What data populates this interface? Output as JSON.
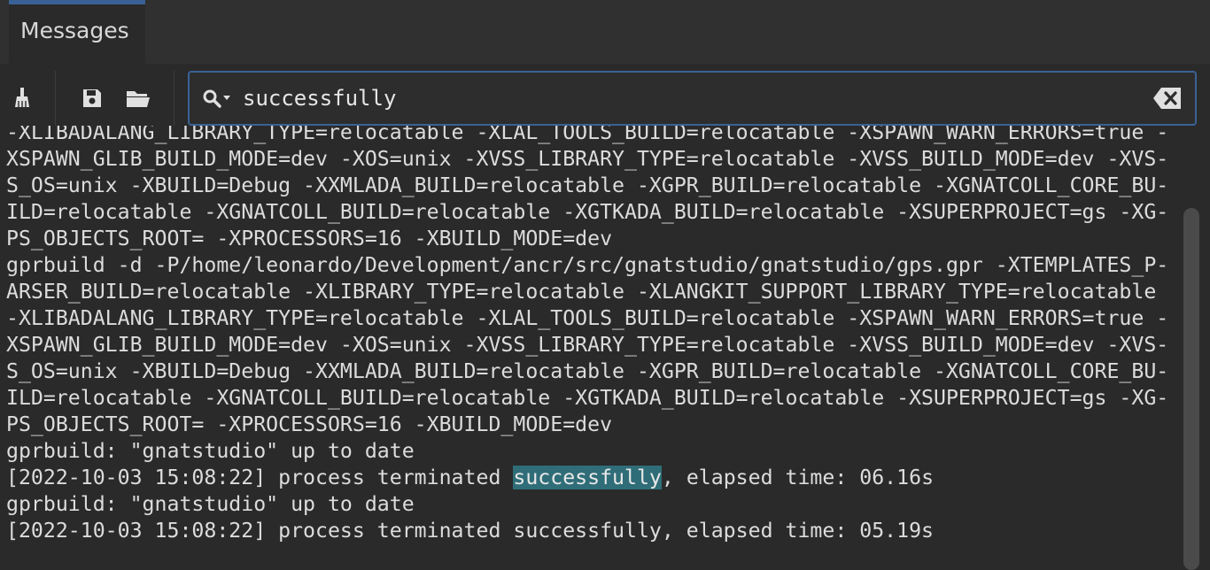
{
  "tab": {
    "label": "Messages"
  },
  "toolbar": {
    "clear_icon": "broom-icon",
    "save_icon": "save-icon",
    "open_icon": "folder-open-icon"
  },
  "search": {
    "value": "successfully",
    "icon": "search-options-icon",
    "clear_icon": "clear-field-icon"
  },
  "console": {
    "highlight_term": "successfully",
    "lines": [
      "-XLIBADALANG_LIBRARY_TYPE=relocatable -XLAL_TOOLS_BUILD=relocatable -XSPAWN_WARN_ERRORS=true -",
      "XSPAWN_GLIB_BUILD_MODE=dev -XOS=unix -XVSS_LIBRARY_TYPE=relocatable -XVSS_BUILD_MODE=dev -XVS-",
      "S_OS=unix -XBUILD=Debug -XXMLADA_BUILD=relocatable -XGPR_BUILD=relocatable -XGNATCOLL_CORE_BU-",
      "ILD=relocatable -XGNATCOLL_BUILD=relocatable -XGTKADA_BUILD=relocatable -XSUPERPROJECT=gs -XG-",
      "PS_OBJECTS_ROOT= -XPROCESSORS=16 -XBUILD_MODE=dev",
      "gprbuild -d -P/home/leonardo/Development/ancr/src/gnatstudio/gnatstudio/gps.gpr -XTEMPLATES_P-",
      "ARSER_BUILD=relocatable -XLIBRARY_TYPE=relocatable -XLANGKIT_SUPPORT_LIBRARY_TYPE=relocatable",
      "-XLIBADALANG_LIBRARY_TYPE=relocatable -XLAL_TOOLS_BUILD=relocatable -XSPAWN_WARN_ERRORS=true -",
      "XSPAWN_GLIB_BUILD_MODE=dev -XOS=unix -XVSS_LIBRARY_TYPE=relocatable -XVSS_BUILD_MODE=dev -XVS-",
      "S_OS=unix -XBUILD=Debug -XXMLADA_BUILD=relocatable -XGPR_BUILD=relocatable -XGNATCOLL_CORE_BU-",
      "ILD=relocatable -XGNATCOLL_BUILD=relocatable -XGTKADA_BUILD=relocatable -XSUPERPROJECT=gs -XG-",
      "PS_OBJECTS_ROOT= -XPROCESSORS=16 -XBUILD_MODE=dev",
      "gprbuild: \"gnatstudio\" up to date",
      "[2022-10-03 15:08:22] process terminated successfully, elapsed time: 06.16s",
      "gprbuild: \"gnatstudio\" up to date",
      "[2022-10-03 15:08:22] process terminated successfully, elapsed time: 05.19s"
    ]
  }
}
